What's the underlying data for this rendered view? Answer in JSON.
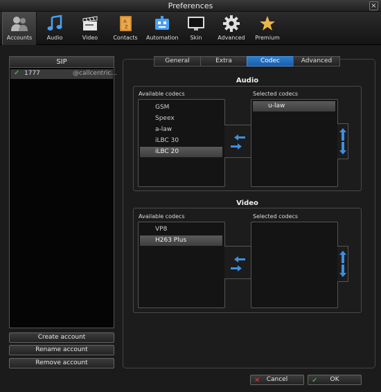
{
  "window": {
    "title": "Preferences",
    "close_glyph": "×"
  },
  "toolbar": {
    "items": [
      {
        "label": "Accounts",
        "icon": "accounts-icon",
        "active": true
      },
      {
        "label": "Audio",
        "icon": "music-note-icon"
      },
      {
        "label": "Video",
        "icon": "clapperboard-icon"
      },
      {
        "label": "Contacts",
        "icon": "address-book-icon"
      },
      {
        "label": "Automation",
        "icon": "robot-icon"
      },
      {
        "label": "Skin",
        "icon": "monitor-icon"
      },
      {
        "label": "Advanced",
        "icon": "gear-icon"
      },
      {
        "label": "Premium",
        "icon": "star-icon"
      }
    ]
  },
  "accounts": {
    "header": "SIP",
    "items": [
      {
        "check": "✓",
        "number": "1777",
        "host": "@callcentric..."
      }
    ],
    "buttons": {
      "create": "Create account",
      "rename": "Rename account",
      "remove": "Remove account"
    }
  },
  "tabs": [
    {
      "label": "General"
    },
    {
      "label": "Extra"
    },
    {
      "label": "Codec",
      "active": true
    },
    {
      "label": "Advanced"
    }
  ],
  "audio": {
    "title": "Audio",
    "available_label": "Available codecs",
    "selected_label": "Selected codecs",
    "available": [
      "GSM",
      "Speex",
      "a-law",
      "iLBC 30",
      "iLBC 20"
    ],
    "available_selected": "iLBC 20",
    "selected": [
      "u-law"
    ]
  },
  "video": {
    "title": "Video",
    "available_label": "Available codecs",
    "selected_label": "Selected codecs",
    "available": [
      "VP8",
      "H263 Plus"
    ],
    "available_selected": "H263 Plus",
    "selected": []
  },
  "footer": {
    "cancel": "Cancel",
    "ok": "OK",
    "cancel_glyph": "✕",
    "ok_glyph": "✓"
  },
  "colors": {
    "accent": "#2e7fd0",
    "arrow": "#3d8fe0",
    "check": "#5fcf5f",
    "cancel_icon": "#d84040"
  }
}
